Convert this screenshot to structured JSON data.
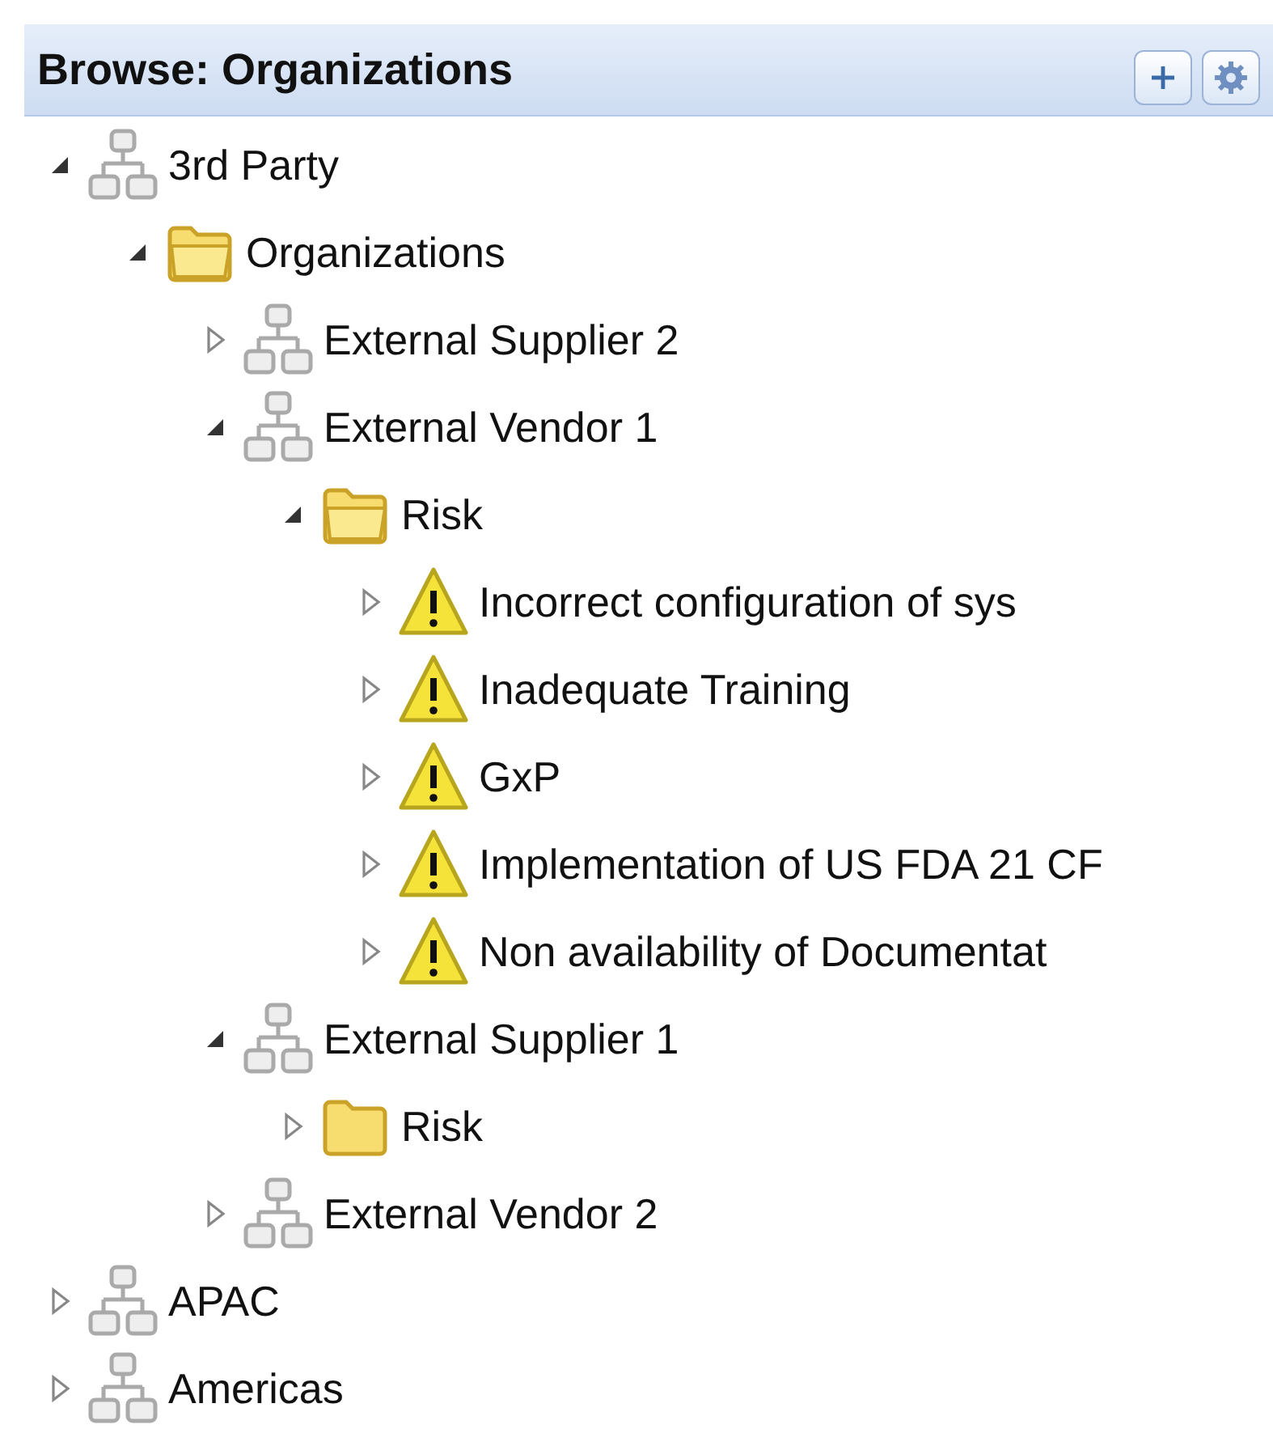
{
  "panel": {
    "title": "Browse: Organizations"
  },
  "tree": [
    {
      "label": "3rd Party",
      "kind": "org",
      "expanded": true,
      "children": [
        {
          "label": "Organizations",
          "kind": "folder",
          "expanded": true,
          "children": [
            {
              "label": "External Supplier 2",
              "kind": "org",
              "expanded": false
            },
            {
              "label": "External Vendor 1",
              "kind": "org",
              "expanded": true,
              "children": [
                {
                  "label": "Risk",
                  "kind": "folder",
                  "expanded": true,
                  "children": [
                    {
                      "label": "Incorrect configuration of sys",
                      "kind": "risk",
                      "expanded": false
                    },
                    {
                      "label": "Inadequate Training",
                      "kind": "risk",
                      "expanded": false
                    },
                    {
                      "label": "GxP",
                      "kind": "risk",
                      "expanded": false
                    },
                    {
                      "label": "Implementation of US FDA 21 CF",
                      "kind": "risk",
                      "expanded": false
                    },
                    {
                      "label": "Non availability of Documentat",
                      "kind": "risk",
                      "expanded": false
                    }
                  ]
                }
              ]
            },
            {
              "label": "External Supplier 1",
              "kind": "org",
              "expanded": true,
              "children": [
                {
                  "label": "Risk",
                  "kind": "folder",
                  "expanded": false
                }
              ]
            },
            {
              "label": "External Vendor 2",
              "kind": "org",
              "expanded": false
            }
          ]
        }
      ]
    },
    {
      "label": "APAC",
      "kind": "org",
      "expanded": false
    },
    {
      "label": "Americas",
      "kind": "org",
      "expanded": false
    }
  ]
}
